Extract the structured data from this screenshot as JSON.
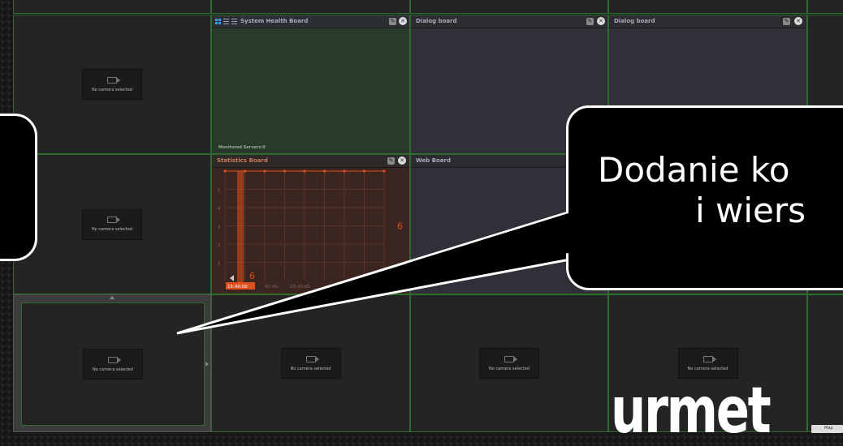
{
  "camera_placeholder": {
    "label": "No camera selected",
    "icon": "camera-icon"
  },
  "boards": {
    "system_health": {
      "title": "System Health Board",
      "footer": "Monitored Servers:0",
      "view_icons": [
        "grid-view-icon",
        "list-view-icon",
        "menu-icon"
      ]
    },
    "dialog_1": {
      "title": "Dialog board"
    },
    "dialog_2": {
      "title": "Dialog board"
    },
    "statistics": {
      "title": "Statistics Board"
    },
    "web": {
      "title": "Web Board"
    }
  },
  "chart_data": {
    "type": "line",
    "y_ticks": [
      "5",
      "4",
      "3",
      "2",
      "1"
    ],
    "x_ticks": [
      "15:40:00",
      "41:00",
      "15:43:00"
    ],
    "current_value": "6",
    "cursor_value": "6",
    "ylim": [
      0,
      6
    ],
    "series": [
      {
        "values": [
          6,
          6,
          6,
          6,
          6,
          6,
          6,
          6,
          6
        ]
      }
    ]
  },
  "callout": {
    "line1": "Dodanie ko",
    "line2": "i wiers"
  },
  "logo": {
    "text": "urmet"
  },
  "map_tab": {
    "label": "Map"
  },
  "colors": {
    "grid_border": "#2f6b2f",
    "accent_orange": "#e0501e",
    "health_board_bg": "#2a3a2a",
    "statistics_bg": "#3a2520"
  }
}
